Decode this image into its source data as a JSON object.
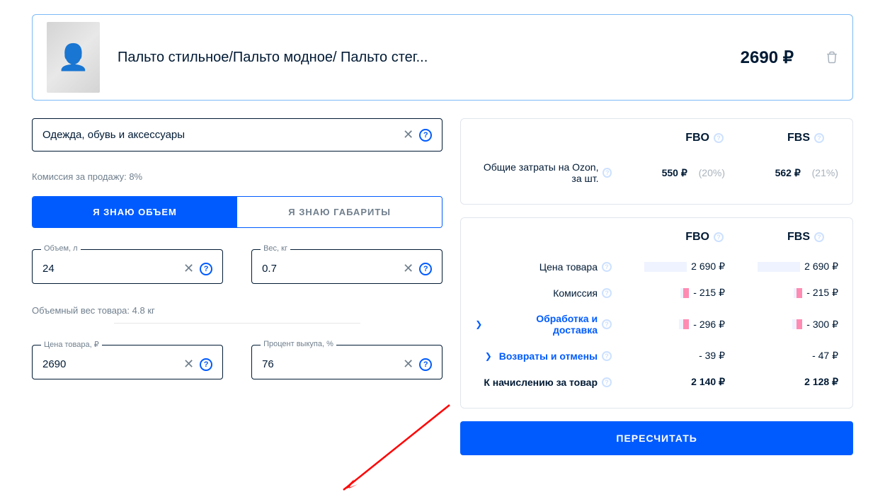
{
  "product": {
    "title": "Пальто стильное/Пальто модное/ Пальто стег...",
    "price": "2690 ₽"
  },
  "category": {
    "value": "Одежда, обувь и аксессуары"
  },
  "commission_text": "Комиссия за продажу: 8%",
  "tabs": {
    "volume": "Я ЗНАЮ ОБЪЕМ",
    "dims": "Я ЗНАЮ ГАБАРИТЫ"
  },
  "inputs": {
    "volume_label": "Объем, л",
    "volume_value": "24",
    "weight_label": "Вес, кг",
    "weight_value": "0.7",
    "price_label": "Цена товара, ₽",
    "price_value": "2690",
    "buyout_label": "Процент выкупа, %",
    "buyout_value": "76"
  },
  "vol_weight": "Объемный вес товара: 4.8 кг",
  "summary": {
    "fbo_label": "FBO",
    "fbs_label": "FBS",
    "total_row_label": "Общие затраты на Ozon, за шт.",
    "total_fbo": "550 ₽",
    "total_fbo_pct": "(20%)",
    "total_fbs": "562 ₽",
    "total_fbs_pct": "(21%)"
  },
  "detail": {
    "fbo_label": "FBO",
    "fbs_label": "FBS",
    "rows": {
      "price_label": "Цена товара",
      "price_fbo": "2 690 ₽",
      "price_fbs": "2 690 ₽",
      "comm_label": "Комиссия",
      "comm_fbo": "- 215 ₽",
      "comm_fbs": "- 215 ₽",
      "proc_label": "Обработка и доставка",
      "proc_fbo": "- 296 ₽",
      "proc_fbs": "- 300 ₽",
      "ret_label": "Возвраты и отмены",
      "ret_fbo": "- 39 ₽",
      "ret_fbs": "- 47 ₽",
      "payout_label": "К начислению за товар",
      "payout_fbo": "2 140 ₽",
      "payout_fbs": "2 128 ₽"
    }
  },
  "recalc": "ПЕРЕСЧИТАТЬ"
}
